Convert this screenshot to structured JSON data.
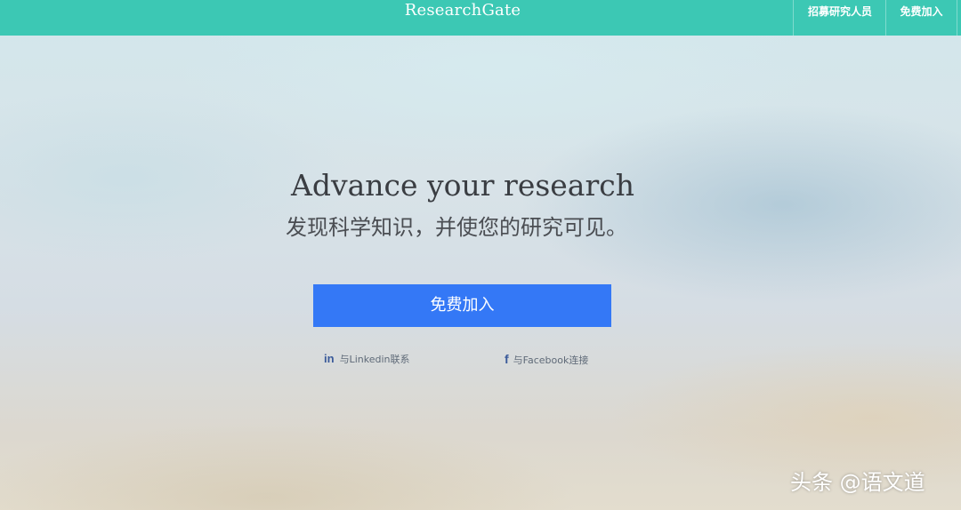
{
  "header": {
    "logo_text": "ResearchGate",
    "nav": {
      "recruit_label": "招募研究人员",
      "join_label": "免费加入"
    }
  },
  "hero": {
    "headline": "Advance your research",
    "subheadline": "发现科学知识，并使您的研究可见。",
    "cta_label": "免费加入"
  },
  "social": {
    "linkedin": {
      "icon_glyph": "in",
      "label": "与Linkedin联系"
    },
    "facebook": {
      "icon_glyph": "f",
      "label": "与Facebook连接"
    }
  },
  "watermark": "头条 @语文道",
  "colors": {
    "header_bg": "#3cc8b4",
    "cta_bg": "#3478f6",
    "social_icon": "#3a5a9a"
  }
}
